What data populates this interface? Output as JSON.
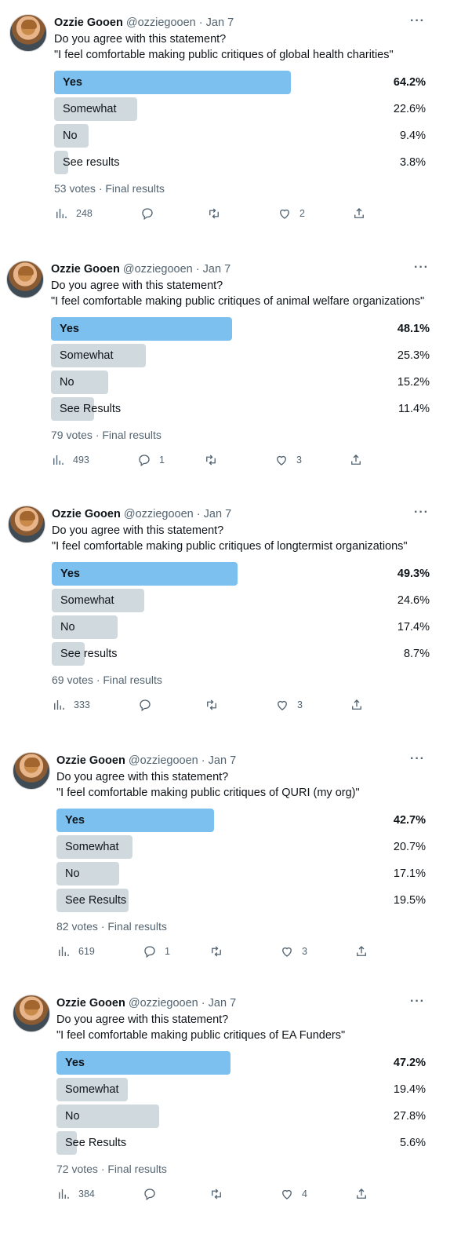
{
  "tweets": [
    {
      "name": "Ozzie Gooen",
      "handle": "@ozziegooen",
      "sep": "·",
      "date": "Jan 7",
      "more": "···",
      "line1": "Do you agree with this statement?",
      "line2": "\"I feel comfortable making public critiques of global health charities\"",
      "options": [
        {
          "label": "Yes",
          "percent": "64.2%",
          "fraction": 0.642,
          "winner": true
        },
        {
          "label": "Somewhat",
          "percent": "22.6%",
          "fraction": 0.226,
          "winner": false
        },
        {
          "label": "No",
          "percent": "9.4%",
          "fraction": 0.094,
          "winner": false
        },
        {
          "label": "See results",
          "percent": "3.8%",
          "fraction": 0.038,
          "winner": false
        }
      ],
      "votes": "53 votes · Final results",
      "views": "248",
      "replies": "",
      "retweets": "",
      "likes": "2"
    },
    {
      "name": "Ozzie Gooen",
      "handle": "@ozziegooen",
      "sep": "·",
      "date": "Jan 7",
      "more": "···",
      "line1": "Do you agree with this statement?",
      "line2": "\"I feel comfortable making public critiques of animal welfare organizations\"",
      "options": [
        {
          "label": "Yes",
          "percent": "48.1%",
          "fraction": 0.481,
          "winner": true
        },
        {
          "label": "Somewhat",
          "percent": "25.3%",
          "fraction": 0.253,
          "winner": false
        },
        {
          "label": "No",
          "percent": "15.2%",
          "fraction": 0.152,
          "winner": false
        },
        {
          "label": "See Results",
          "percent": "11.4%",
          "fraction": 0.114,
          "winner": false
        }
      ],
      "votes": "79 votes · Final results",
      "views": "493",
      "replies": "1",
      "retweets": "",
      "likes": "3"
    },
    {
      "name": "Ozzie Gooen",
      "handle": "@ozziegooen",
      "sep": "·",
      "date": "Jan 7",
      "more": "···",
      "line1": "Do you agree with this statement?",
      "line2": "\"I feel comfortable making public critiques of longtermist organizations\"",
      "options": [
        {
          "label": "Yes",
          "percent": "49.3%",
          "fraction": 0.493,
          "winner": true
        },
        {
          "label": "Somewhat",
          "percent": "24.6%",
          "fraction": 0.246,
          "winner": false
        },
        {
          "label": "No",
          "percent": "17.4%",
          "fraction": 0.174,
          "winner": false
        },
        {
          "label": "See results",
          "percent": "8.7%",
          "fraction": 0.087,
          "winner": false
        }
      ],
      "votes": "69 votes · Final results",
      "views": "333",
      "replies": "",
      "retweets": "",
      "likes": "3"
    },
    {
      "name": "Ozzie Gooen",
      "handle": "@ozziegooen",
      "sep": "·",
      "date": "Jan 7",
      "more": "···",
      "line1": "Do you agree with this statement?",
      "line2": "\"I feel comfortable making public critiques of QURI (my org)\"",
      "options": [
        {
          "label": "Yes",
          "percent": "42.7%",
          "fraction": 0.427,
          "winner": true
        },
        {
          "label": "Somewhat",
          "percent": "20.7%",
          "fraction": 0.207,
          "winner": false
        },
        {
          "label": "No",
          "percent": "17.1%",
          "fraction": 0.171,
          "winner": false
        },
        {
          "label": "See Results",
          "percent": "19.5%",
          "fraction": 0.195,
          "winner": false
        }
      ],
      "votes": "82 votes · Final results",
      "views": "619",
      "replies": "1",
      "retweets": "",
      "likes": "3"
    },
    {
      "name": "Ozzie Gooen",
      "handle": "@ozziegooen",
      "sep": "·",
      "date": "Jan 7",
      "more": "···",
      "line1": "Do you agree with this statement?",
      "line2": "\"I feel comfortable making public critiques of EA Funders\"",
      "options": [
        {
          "label": "Yes",
          "percent": "47.2%",
          "fraction": 0.472,
          "winner": true
        },
        {
          "label": "Somewhat",
          "percent": "19.4%",
          "fraction": 0.194,
          "winner": false
        },
        {
          "label": "No",
          "percent": "27.8%",
          "fraction": 0.278,
          "winner": false
        },
        {
          "label": "See Results",
          "percent": "5.6%",
          "fraction": 0.056,
          "winner": false
        }
      ],
      "votes": "72 votes · Final results",
      "views": "384",
      "replies": "",
      "retweets": "",
      "likes": "4"
    }
  ],
  "colors": {
    "winner_bar": "#7cc0ef",
    "other_bar": "#cfd9de",
    "muted_text": "#536471"
  },
  "icons": {
    "views": "bar-chart-icon",
    "reply": "reply-icon",
    "retweet": "retweet-icon",
    "like": "heart-icon",
    "share": "share-icon"
  }
}
